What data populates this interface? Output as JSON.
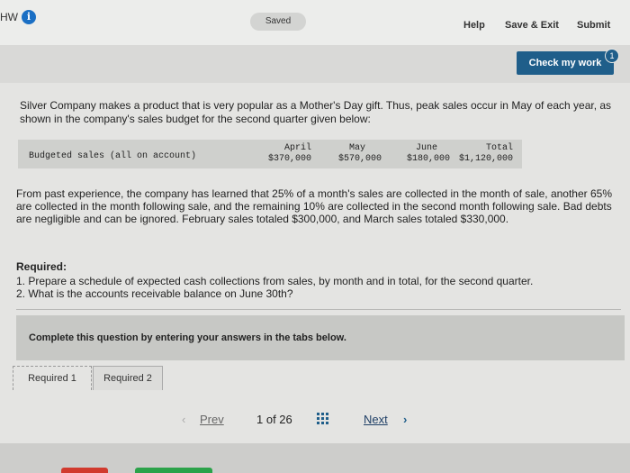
{
  "header": {
    "hw": "HW",
    "info": "i",
    "saved": "Saved",
    "help": "Help",
    "save_exit": "Save & Exit",
    "submit": "Submit"
  },
  "check": {
    "label": "Check my work",
    "badge": "1"
  },
  "question": {
    "intro": "Silver Company makes a product that is very popular as a Mother's Day gift. Thus, peak sales occur in May of each year, as shown in the company's sales budget for the second quarter given below:",
    "budget_label": "Budgeted sales (all on account)",
    "months": [
      {
        "name": "April",
        "value": "$370,000"
      },
      {
        "name": "May",
        "value": "$570,000"
      },
      {
        "name": "June",
        "value": "$180,000"
      },
      {
        "name": "Total",
        "value": "$1,120,000"
      }
    ],
    "paragraph": "From past experience, the company has learned that 25% of a month's sales are collected in the month of sale, another 65% are collected in the month following sale, and the remaining 10% are collected in the second month following sale. Bad debts are negligible and can be ignored. February sales totaled $300,000, and March sales totaled $330,000.",
    "required_title": "Required:",
    "required_items": [
      "1. Prepare a schedule of expected cash collections from sales, by month and in total, for the second quarter.",
      "2. What is the accounts receivable balance on June 30th?"
    ]
  },
  "instructions": "Complete this question by entering your answers in the tabs below.",
  "tabs": [
    "Required 1",
    "Required 2"
  ],
  "pager": {
    "prev": "Prev",
    "page_info": "1 of 26",
    "next": "Next"
  },
  "colors": {
    "accent": "#1f5e8a",
    "info": "#1a6fc4"
  }
}
